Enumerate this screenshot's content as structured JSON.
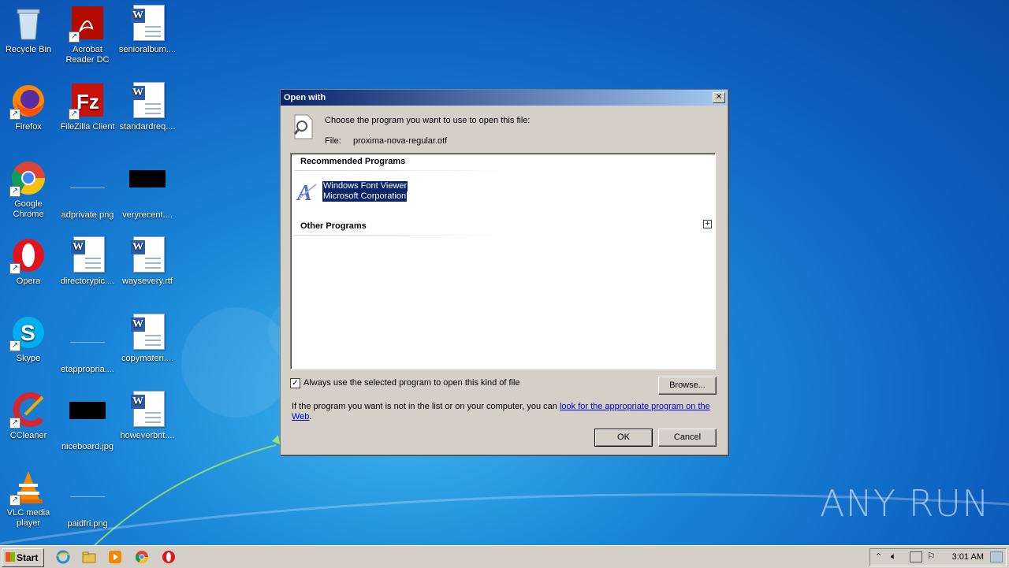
{
  "desktop": {
    "icons": [
      {
        "label": "Recycle Bin"
      },
      {
        "label": "Acrobat Reader DC"
      },
      {
        "label": "senioralbum...."
      },
      {
        "label": "Firefox"
      },
      {
        "label": "FileZilla Client"
      },
      {
        "label": "standardreq...."
      },
      {
        "label": "Google Chrome"
      },
      {
        "label": "adprivate.png"
      },
      {
        "label": "veryrecent...."
      },
      {
        "label": "Opera"
      },
      {
        "label": "directorypic...."
      },
      {
        "label": "waysevery.rtf"
      },
      {
        "label": "Skype"
      },
      {
        "label": "etappropria...."
      },
      {
        "label": "copymateri...."
      },
      {
        "label": "CCleaner"
      },
      {
        "label": "niceboard.jpg"
      },
      {
        "label": "howeverbrit...."
      },
      {
        "label": "VLC media player"
      },
      {
        "label": "paidfri.png"
      }
    ],
    "watermark": "ANY RUN"
  },
  "dialog": {
    "title": "Open with",
    "close_glyph": "✕",
    "prompt": "Choose the program you want to use to open this file:",
    "file_label": "File:",
    "file_name": "proxima-nova-regular.otf",
    "recommended_header": "Recommended Programs",
    "program_name": "Windows Font Viewer",
    "program_company": "Microsoft Corporation",
    "other_header": "Other Programs",
    "expand_glyph": "+",
    "always_checked": true,
    "always_label": "Always use the selected program to open this kind of file",
    "browse_label": "Browse...",
    "info_text": "If the program you want is not in the list or on your computer, you can ",
    "info_link": "look for the appropriate program on the Web",
    "info_end": ".",
    "ok_label": "OK",
    "cancel_label": "Cancel"
  },
  "taskbar": {
    "start_label": "Start",
    "clock": "3:01 AM",
    "pinned": [
      "ie-icon",
      "explorer-icon",
      "media-player-icon",
      "chrome-icon",
      "opera-icon"
    ]
  }
}
